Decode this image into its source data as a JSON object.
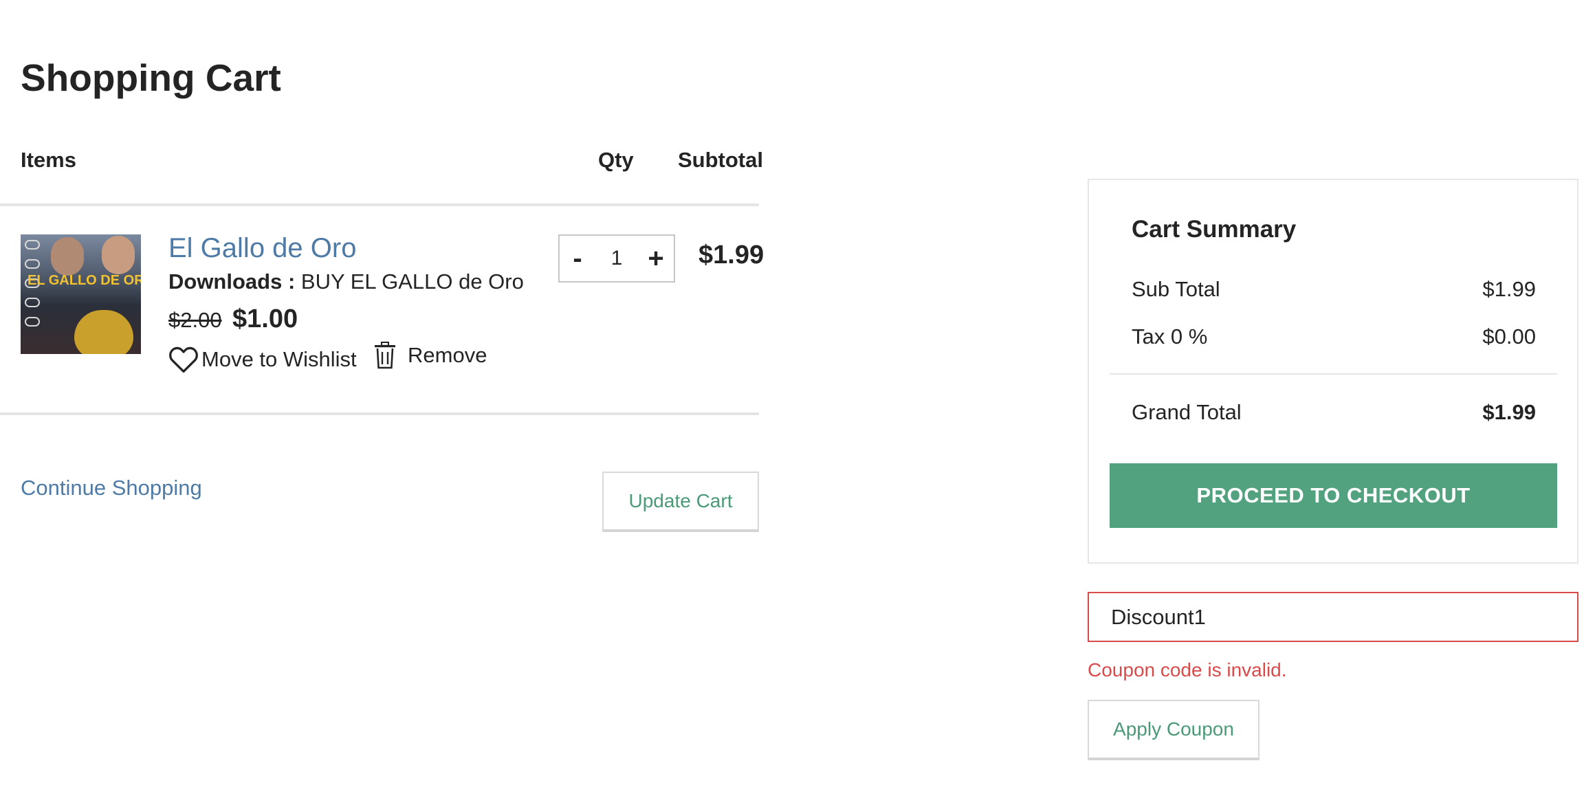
{
  "page": {
    "title": "Shopping Cart"
  },
  "columns": {
    "items": "Items",
    "qty": "Qty",
    "subtotal": "Subtotal"
  },
  "item": {
    "name": "El Gallo de Oro",
    "option_label": "Downloads :",
    "option_value": "BUY EL GALLO de Oro",
    "old_price": "$2.00",
    "price": "$1.00",
    "quantity": "1",
    "qty_minus": "-",
    "qty_plus": "+",
    "line_subtotal": "$1.99",
    "wishlist_label": "Move to Wishlist",
    "remove_label": "Remove",
    "thumbnail": {
      "poster_title": "EL GALLO DE ORO"
    }
  },
  "actions": {
    "continue_label": "Continue Shopping",
    "update_label": "Update Cart"
  },
  "summary": {
    "title": "Cart Summary",
    "subtotal_label": "Sub Total",
    "subtotal_value": "$1.99",
    "tax_label": "Tax 0 %",
    "tax_value": "$0.00",
    "grand_total_label": "Grand Total",
    "grand_total_value": "$1.99",
    "checkout_label": "PROCEED TO CHECKOUT"
  },
  "coupon": {
    "value": "Discount1",
    "error": "Coupon code is invalid.",
    "apply_label": "Apply Coupon"
  },
  "colors": {
    "link": "#4e7aa6",
    "accent_green": "#52a27f",
    "error_red": "#d94a4a"
  }
}
